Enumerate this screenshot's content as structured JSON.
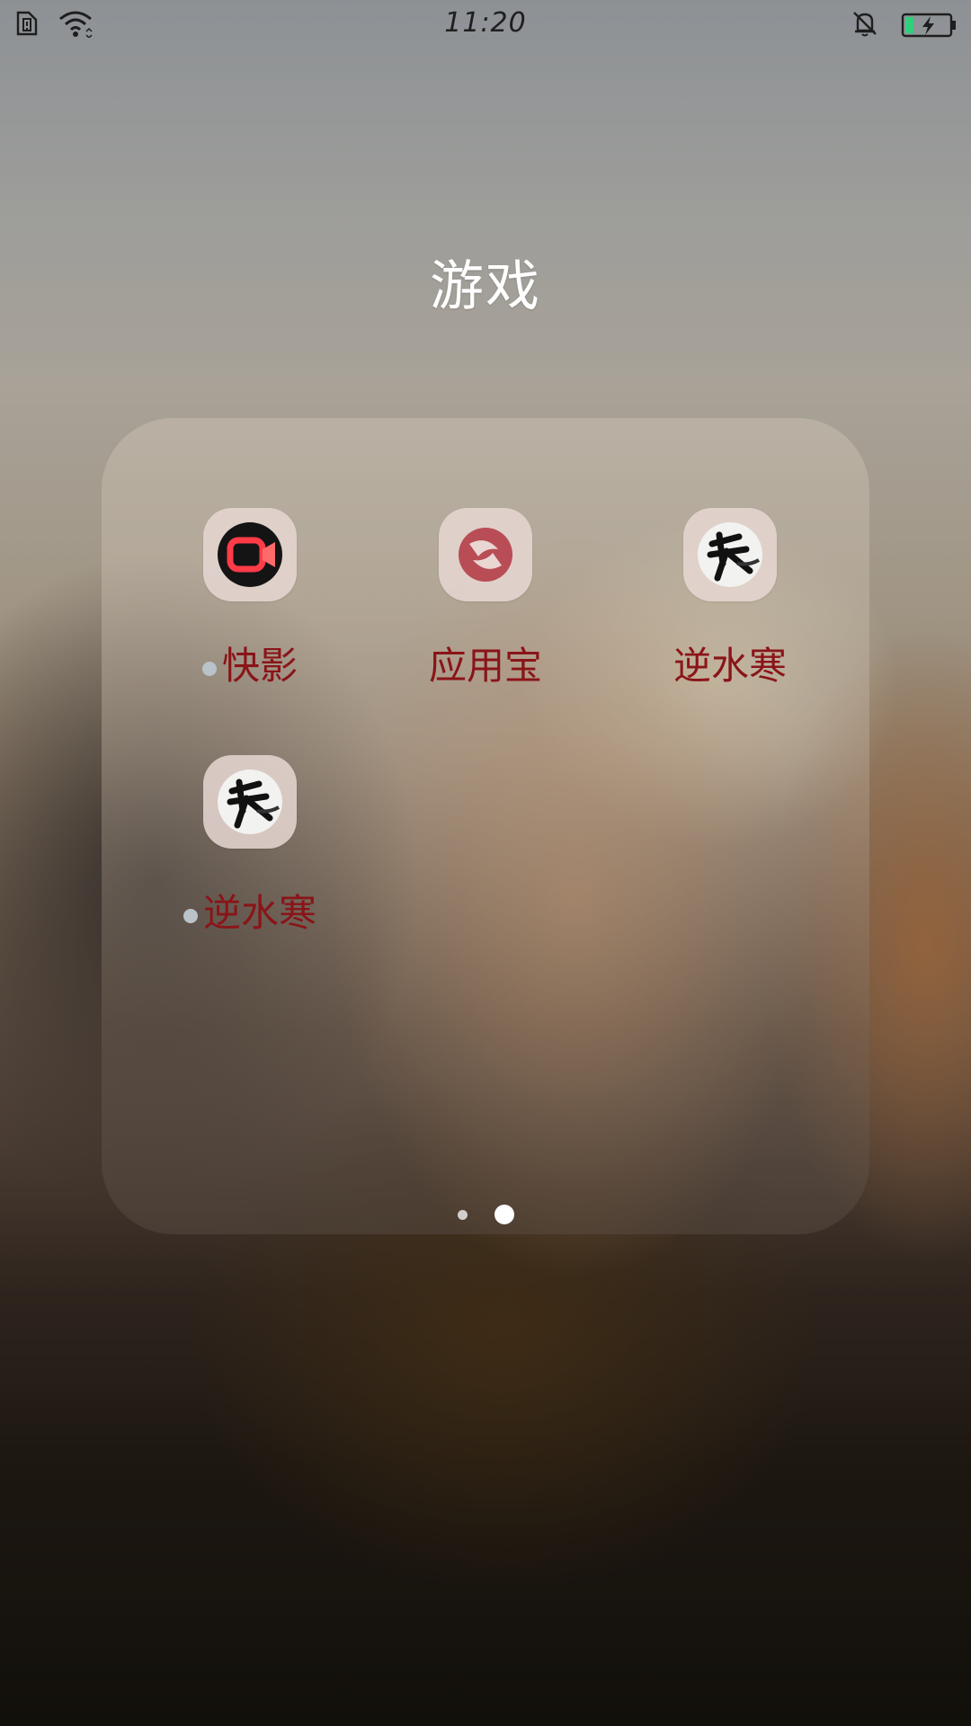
{
  "status_bar": {
    "time": "11:20",
    "icons": [
      "sim-alert-icon",
      "wifi-icon",
      "bell-muted-icon",
      "battery-charging-icon"
    ],
    "battery_color": "#2fd07a"
  },
  "folder": {
    "title": "游戏",
    "apps": [
      {
        "label": "快影",
        "icon": "kuaiying-app-icon",
        "new": true
      },
      {
        "label": "应用宝",
        "icon": "yingyongbao-app-icon",
        "new": false
      },
      {
        "label": "逆水寒",
        "icon": "nishuihan-app-icon",
        "new": false
      },
      {
        "label": "逆水寒",
        "icon": "nishuihan-app-icon",
        "new": true
      }
    ],
    "page_indicator": {
      "pages": 2,
      "current": 2
    }
  },
  "colors": {
    "label_text": "#8a1418",
    "title_text": "#ffffff"
  }
}
